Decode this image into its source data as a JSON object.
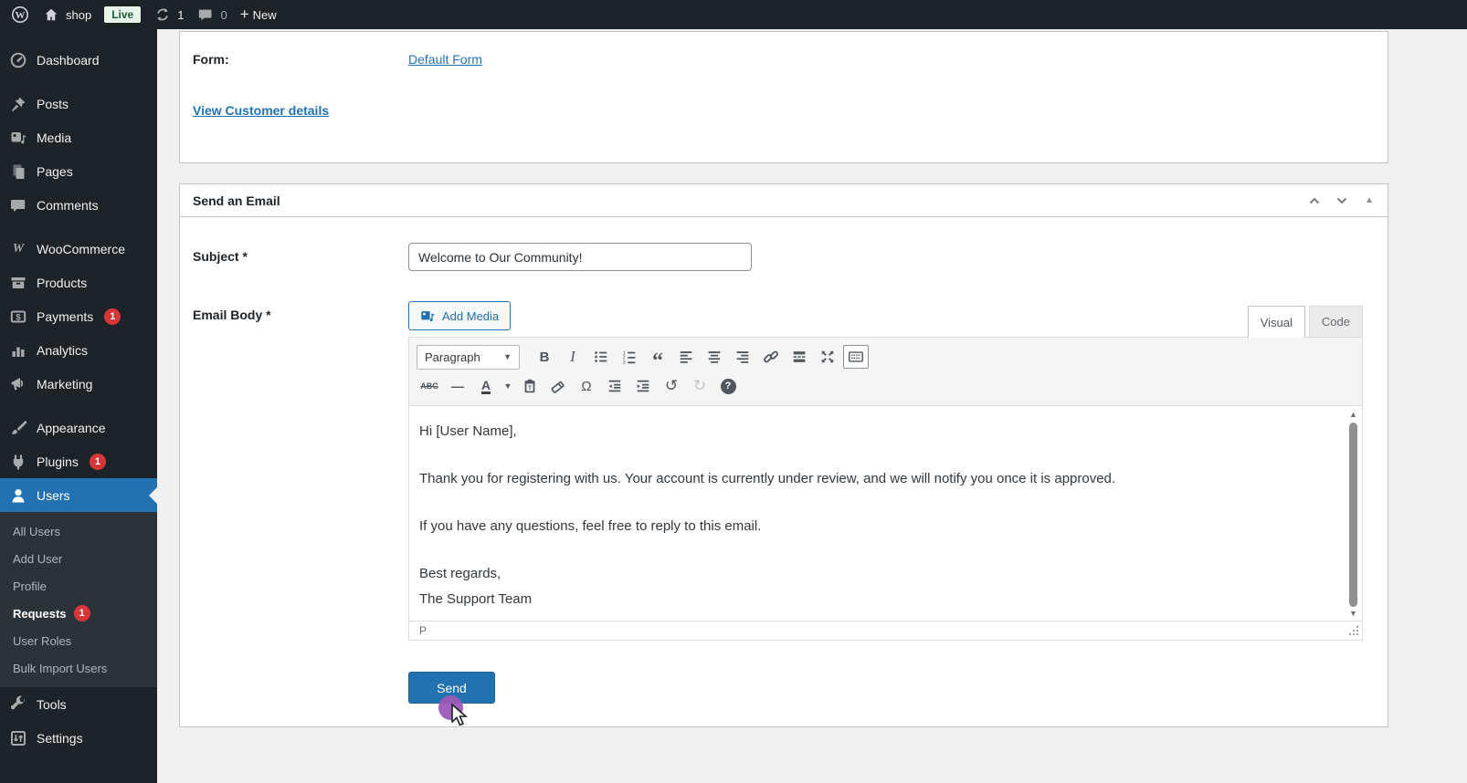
{
  "admin_bar": {
    "site_name": "shop",
    "live_badge": "Live",
    "updates_count": "1",
    "comments_count": "0",
    "new_label": "New"
  },
  "sidebar": {
    "items": [
      "Dashboard",
      "Posts",
      "Media",
      "Pages",
      "Comments",
      "WooCommerce",
      "Products",
      "Payments",
      "Analytics",
      "Marketing",
      "Appearance",
      "Plugins",
      "Users",
      "Tools",
      "Settings"
    ],
    "badges": {
      "payments": "1",
      "plugins": "1",
      "requests": "1"
    },
    "users_submenu": [
      "All Users",
      "Add User",
      "Profile",
      "Requests",
      "User Roles",
      "Bulk Import Users"
    ]
  },
  "detail_panel": {
    "form_label": "Form:",
    "form_value": "Default Form",
    "view_customer_link": "View Customer details"
  },
  "email_panel": {
    "title": "Send an Email",
    "subject_label": "Subject *",
    "subject_value": "Welcome to Our Community!",
    "body_label": "Email Body *",
    "add_media_label": "Add Media",
    "visual_tab": "Visual",
    "code_tab": "Code",
    "toolbar": {
      "paragraph": "Paragraph",
      "bold": "B",
      "italic": "I",
      "blockquote": "“",
      "strikethrough": "ABC",
      "hr": "—",
      "text_color": "A",
      "special_char": "Ω",
      "undo": "↺",
      "redo": "↻",
      "help": "?"
    },
    "editor_paragraphs": [
      "Hi [User Name],",
      "Thank you for registering with us. Your account is currently under review, and we will notify you once it is approved.",
      "If you have any questions, feel free to reply to this email.",
      "Best regards,",
      "The Support Team"
    ],
    "status_path": "P",
    "send_label": "Send"
  },
  "colors": {
    "accent_blue": "#2271b1",
    "badge_red": "#d63638",
    "admin_dark": "#1d2327",
    "submenu_dark": "#2c3338",
    "content_bg": "#f0f0f1",
    "cursor_purple": "#9b59b6",
    "live_badge_bg": "#e6f4ea",
    "live_badge_text": "#1e5c35"
  }
}
